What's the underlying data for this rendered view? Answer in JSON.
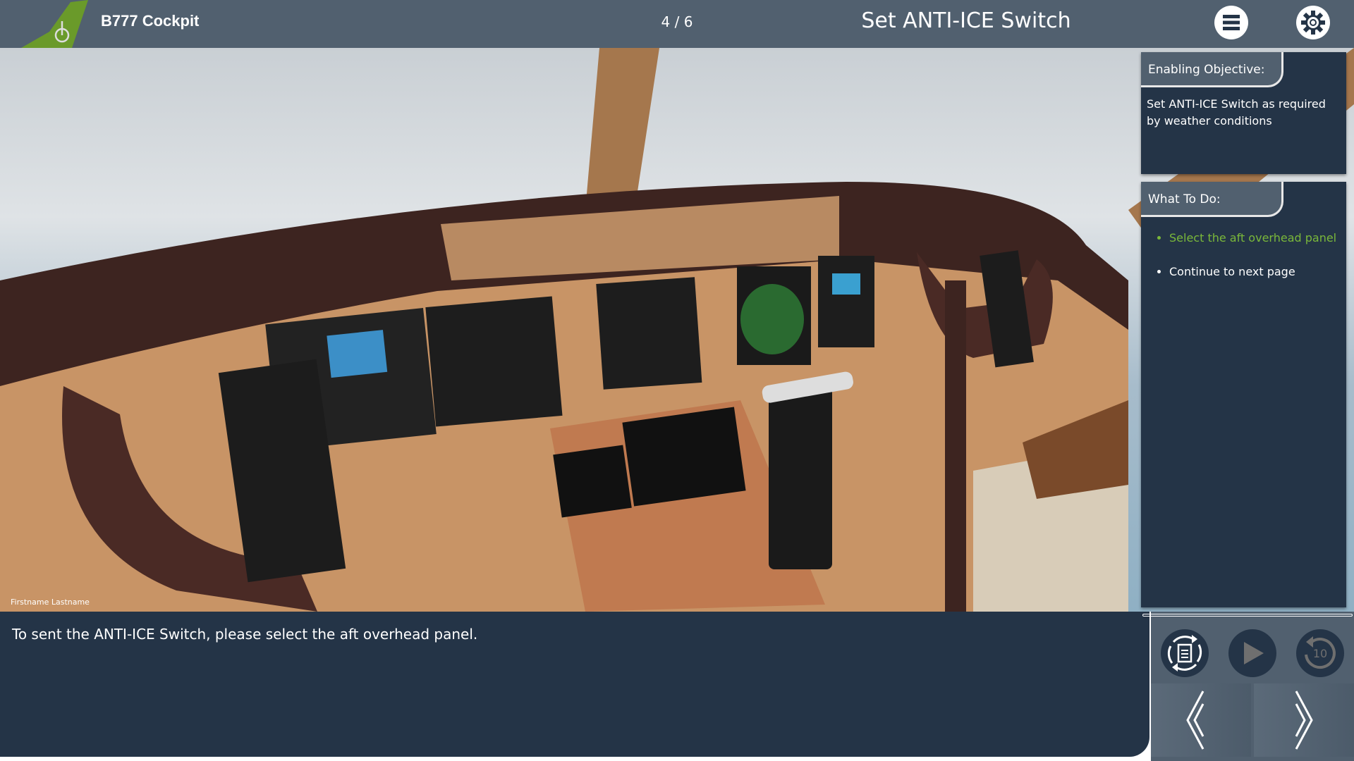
{
  "header": {
    "app_title": "B777 Cockpit",
    "page_count": "4 / 6",
    "page_title": "Set ANTI-ICE Switch",
    "menu_icon": "hamburger-menu-icon",
    "settings_icon": "gear-icon"
  },
  "scene": {
    "watermark": "Firstname Lastname"
  },
  "objective": {
    "heading": "Enabling Objective:",
    "text": "Set ANTI-ICE Switch as required by weather conditions"
  },
  "todo": {
    "heading": "What To Do:",
    "items": [
      {
        "label": "Select the aft overhead panel",
        "active": true
      },
      {
        "label": "Continue to next page",
        "active": false
      }
    ]
  },
  "caption": {
    "text": "To sent the ANTI-ICE Switch, please select the aft overhead panel."
  },
  "controls": {
    "replay_icon": "replay-document-icon",
    "play_icon": "play-icon",
    "rewind_icon": "rewind-10-icon",
    "rewind_label": "10",
    "prev_icon": "double-chevron-left-icon",
    "next_icon": "chevron-right-icon",
    "progress": 0
  },
  "colors": {
    "header": "#51606f",
    "panel": "#243447",
    "accent_green": "#7ab83a"
  }
}
